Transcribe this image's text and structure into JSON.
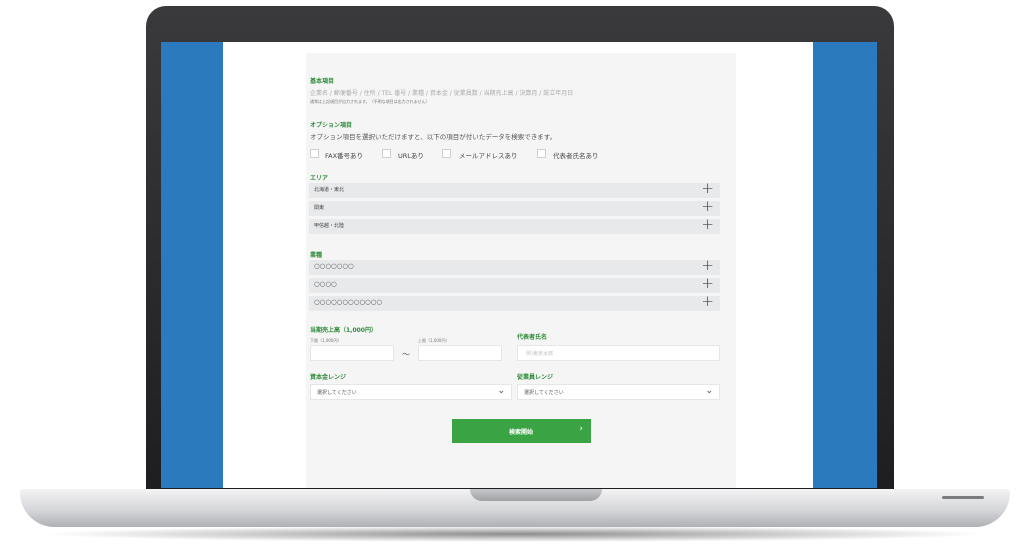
{
  "basic": {
    "title": "基本項目",
    "fields": "企業名 / 郵便番号 / 住所 / TEL 番号 / 業種 / 資本金 / 従業員数 / 当期売上高 / 決算月 / 設立年月日",
    "note": "通常は上記項目が出力されます。（不明な項目は出力されません）"
  },
  "options": {
    "title": "オプション項目",
    "description": "オプション項目を選択いただけますと、以下の項目が付いたデータを検索できます。",
    "items": [
      "FAX番号あり",
      "URLあり",
      "メールアドレスあり",
      "代表者氏名あり"
    ]
  },
  "area": {
    "title": "エリア",
    "rows": [
      "北海道・東北",
      "関東",
      "甲信越・北陸"
    ]
  },
  "industry": {
    "title": "業種",
    "rows": [
      "○○○○○○○",
      "○○○○",
      "○○○○○○○○○○○○"
    ]
  },
  "sales": {
    "title": "当期売上高（1,000円）",
    "min_label": "下限（1,000円）",
    "max_label": "上限（1,000円）",
    "tilde": "～"
  },
  "representative": {
    "title": "代表者氏名",
    "placeholder": "例)東京太郎"
  },
  "capital": {
    "title": "資本金レンジ",
    "value": "選択してください"
  },
  "employees": {
    "title": "従業員レンジ",
    "value": "選択してください"
  },
  "search_button": {
    "label": "検索開始",
    "arrow": "›"
  },
  "icons": {
    "plus": "+",
    "chevron": "⌄"
  },
  "colors": {
    "accent_green": "#3aa444",
    "title_green": "#2e8b3a",
    "screen_blue": "#2a7abd",
    "panel_bg": "#f4f5f4",
    "row_bg": "#e7e9eb"
  }
}
